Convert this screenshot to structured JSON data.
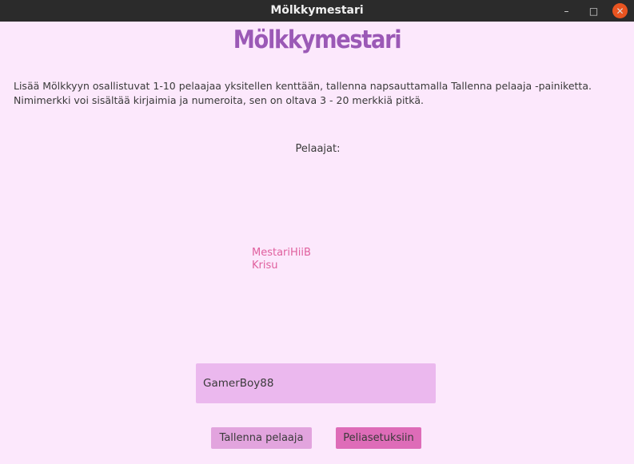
{
  "window": {
    "title": "Mölkkymestari",
    "minimize_glyph": "–",
    "maximize_glyph": "□",
    "close_glyph": "✕"
  },
  "app": {
    "heading": "Mölkkymestari",
    "instructions": [
      "Lisää Mölkkyyn osallistuvat 1-10 pelaajaa yksitellen kenttään, tallenna napsauttamalla Tallenna pelaaja -painiketta.",
      "Nimimerkki voi sisältää kirjaimia ja numeroita, sen on oltava 3 - 20 merkkiä pitkä."
    ],
    "players_label": "Pelaajat:",
    "players": [
      "MestariHiiB",
      "Krisu"
    ],
    "name_input_value": "GamerBoy88",
    "save_button_label": "Tallenna pelaaja",
    "settings_button_label": "Peliasetuksiin"
  },
  "colors": {
    "background": "#fce8fc",
    "title_purple": "#9b59b6",
    "player_pink": "#e0609e",
    "input_bg": "#ebb8ee",
    "save_button": "#e2a4de",
    "settings_button": "#de6cb8",
    "titlebar": "#2b2b2b",
    "close_orange": "#e95420"
  }
}
